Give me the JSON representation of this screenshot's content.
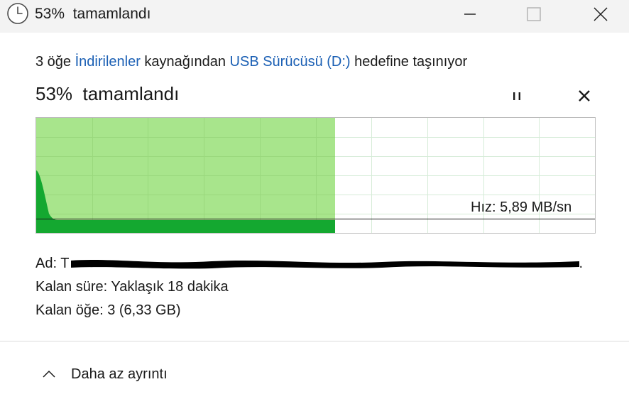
{
  "window": {
    "title": "53%  tamamlandı",
    "icon": "clock-icon"
  },
  "transfer": {
    "count_text": "3 öğe ",
    "source_link": "İndirilenler",
    "middle_text": " kaynağından ",
    "dest_link": "USB Sürücüsü (D:)",
    "suffix_text": " hedefine taşınıyor"
  },
  "progress": {
    "headline": "53%  tamamlandı",
    "percent": 53
  },
  "controls": {
    "pause_icon": "pause-icon",
    "cancel_icon": "close-icon"
  },
  "graph": {
    "speed_label": "Hız: 5,89 MB/sn",
    "fill_color": "#a8e58c",
    "speed_fill_color": "#14a830",
    "grid_color": "#d6ecd8"
  },
  "details": {
    "name_label": "Ad: ",
    "name_first_char": "T",
    "name_end_char": ".",
    "remaining_time_label": "Kalan süre: ",
    "remaining_time_value": "Yaklaşık 18 dakika",
    "remaining_items_label": "Kalan öğe: ",
    "remaining_items_value": "3 (6,33 GB)"
  },
  "footer": {
    "toggle_label": "Daha az ayrıntı",
    "toggle_icon": "chevron-up-icon"
  }
}
